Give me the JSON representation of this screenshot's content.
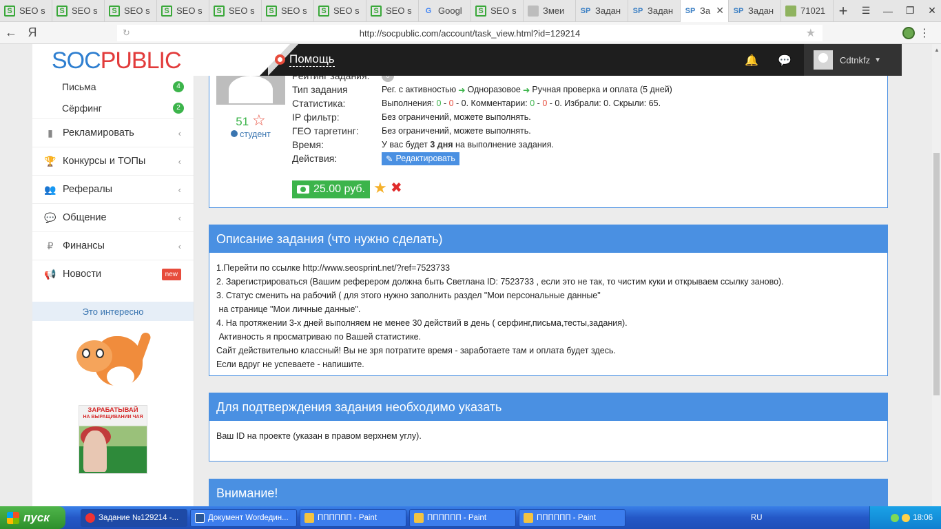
{
  "browser": {
    "tabs": [
      {
        "title": "SEO s",
        "icon": "seosprint-icon"
      },
      {
        "title": "SEO s",
        "icon": "seosprint-icon"
      },
      {
        "title": "SEO s",
        "icon": "seosprint-icon"
      },
      {
        "title": "SEO s",
        "icon": "seosprint-icon"
      },
      {
        "title": "SEO s",
        "icon": "seosprint-icon"
      },
      {
        "title": "SEO s",
        "icon": "seosprint-icon"
      },
      {
        "title": "SEO s",
        "icon": "seosprint-icon"
      },
      {
        "title": "SEO s",
        "icon": "seosprint-icon"
      },
      {
        "title": "Googl",
        "icon": "google-icon"
      },
      {
        "title": "SEO s",
        "icon": "seosprint-icon"
      },
      {
        "title": "Змеи",
        "icon": "generic-page-icon"
      },
      {
        "title": "Задан",
        "icon": "socpublic-icon"
      },
      {
        "title": "Задан",
        "icon": "socpublic-icon"
      },
      {
        "title": "За",
        "icon": "socpublic-icon",
        "active": true
      },
      {
        "title": "Задан",
        "icon": "socpublic-icon"
      },
      {
        "title": "71021",
        "icon": "image-icon"
      }
    ],
    "url": "http://socpublic.com/account/task_view.html?id=129214"
  },
  "header": {
    "logo_soc": "SOC",
    "logo_public": "PUBLIC",
    "help": "Помощь",
    "username": "Cdtnkfz"
  },
  "sidebar": {
    "sub_items": [
      {
        "label": "Письма",
        "badge": "4"
      },
      {
        "label": "Сёрфинг",
        "badge": "2"
      }
    ],
    "items": [
      {
        "label": "Рекламировать",
        "icon": "bar-chart-icon"
      },
      {
        "label": "Конкурсы и ТОПы",
        "icon": "trophy-icon"
      },
      {
        "label": "Рефералы",
        "icon": "users-icon"
      },
      {
        "label": "Общение",
        "icon": "comments-icon"
      },
      {
        "label": "Финансы",
        "icon": "ruble-icon"
      },
      {
        "label": "Новости",
        "icon": "bullhorn-icon",
        "badge": "new"
      }
    ],
    "interesting": "Это интересно",
    "ad_title": "ЗАРАБАТЫВАЙ",
    "ad_subtitle": "НА ВЫРАЩИВАНИИ ЧАЯ"
  },
  "task": {
    "author_score": "51",
    "author_rank": "студент",
    "rows": {
      "rating_label": "Рейтинг задания:",
      "rating_value": "0",
      "type_label": "Тип задания",
      "type_1": "Рег. с активностью",
      "type_2": "Одноразовое",
      "type_3": "Ручная проверка и оплата (5 дней)",
      "stats_label": "Статистика:",
      "stats_exec": "Выполнения:",
      "stats_exec_g": "0",
      "stats_exec_r": "0",
      "stats_exec_n": "0",
      "stats_comm": ". Комментарии:",
      "stats_comm_g": "0",
      "stats_comm_r": "0",
      "stats_comm_n": "0",
      "stats_rest": ". Избрали: 0. Скрыли: 65.",
      "ip_label": "IP фильтр:",
      "ip_value": "Без ограничений, можете выполнять.",
      "geo_label": "ГЕО таргетинг:",
      "geo_value": "Без ограничений, можете выполнять.",
      "time_label": "Время:",
      "time_pre": "У вас будет",
      "time_bold": "3 дня",
      "time_post": "на выполнение задания.",
      "actions_label": "Действия:",
      "edit": "Редактировать"
    },
    "price": "25.00 руб."
  },
  "description": {
    "title": "Описание задания (что нужно сделать)",
    "lines": [
      "1.Перейти по ссылке  http://www.seosprint.net/?ref=7523733",
      "2. Зарегистрироваться  (Вашим реферером должна быть Светлана ID: 7523733 , если это не так, то чистим куки и открываем ссылку заново).",
      "3. Статус сменить на рабочий ( для этого нужно заполнить раздел \"Мои персональные данные\"",
      " на странице \"Мои личные данные\".",
      "4. На протяжении 3-х дней выполняем не менее 30 действий в день ( серфинг,письма,тесты,задания).",
      " Активность я просматриваю по Вашей статистике.",
      "Сайт действительно классный! Вы не зря потратите время - заработаете там и оплата будет здесь.",
      "Если вдруг не успеваете - напишите."
    ]
  },
  "confirm": {
    "title": "Для подтверждения задания необходимо указать",
    "text": "Ваш ID на проекте (указан в правом верхнем углу)."
  },
  "attention": {
    "title": "Внимание!"
  },
  "taskbar": {
    "start": "пуск",
    "tasks": [
      {
        "label": "Задание №129214 -...",
        "icon": "yandex-browser-icon"
      },
      {
        "label": "Документ Wordедин...",
        "icon": "word-document-icon"
      },
      {
        "label": "ПППППП - Paint",
        "icon": "paint-icon"
      },
      {
        "label": "ПППППП - Paint",
        "icon": "paint-icon"
      },
      {
        "label": "ПППППП - Paint",
        "icon": "paint-icon"
      }
    ],
    "lang": "RU",
    "clock": "18:06"
  }
}
